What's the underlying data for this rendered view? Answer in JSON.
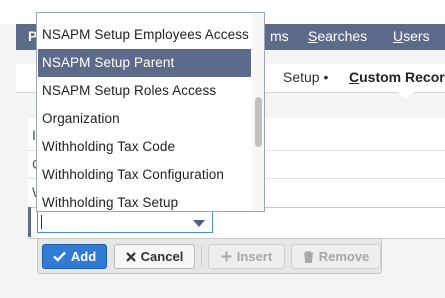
{
  "nav": {
    "first": "P",
    "items": [
      {
        "rest": "ms"
      },
      {
        "first": "S",
        "rest": "earches"
      },
      {
        "first": "U",
        "rest": "sers"
      }
    ]
  },
  "breadcrumb": {
    "setup": "Setup",
    "setup_dot": "•",
    "custom_first": "C",
    "custom_rest": "ustom Recor"
  },
  "left_letters": [
    "I",
    "C",
    "W"
  ],
  "dropdown": {
    "top_partial": "NSAPM Setup Employees Access (partial)",
    "items": [
      {
        "label": "NSAPM Setup Employees Access",
        "selected": false
      },
      {
        "label": "NSAPM Setup Parent",
        "selected": true
      },
      {
        "label": "NSAPM Setup Roles Access",
        "selected": false
      },
      {
        "label": "Organization",
        "selected": false
      },
      {
        "label": "Withholding Tax Code",
        "selected": false
      },
      {
        "label": "Withholding Tax Configuration",
        "selected": false
      },
      {
        "label": "Withholding Tax Setup",
        "selected": false
      }
    ]
  },
  "select": {
    "value": "",
    "arrow_icon": "chevron-down-icon"
  },
  "buttons": {
    "add": "Add",
    "cancel": "Cancel",
    "insert": "Insert",
    "remove": "Remove"
  },
  "colors": {
    "nav_bg": "#5c6b8a",
    "selected_bg": "#5c6b8a",
    "add_button": "#2f7bd6",
    "focus_border": "#4e8ad6"
  }
}
